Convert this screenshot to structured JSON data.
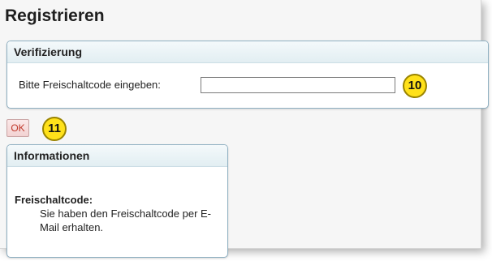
{
  "page": {
    "title": "Registrieren"
  },
  "verification": {
    "heading": "Verifizierung",
    "code_label": "Bitte Freischaltcode eingeben:",
    "code_value": "",
    "badge": "10"
  },
  "ok_button": {
    "label": "OK",
    "badge": "11"
  },
  "info": {
    "heading": "Informationen",
    "term": "Freischaltcode:",
    "description": "Sie haben den Freischaltcode per E-Mail erhalten."
  }
}
